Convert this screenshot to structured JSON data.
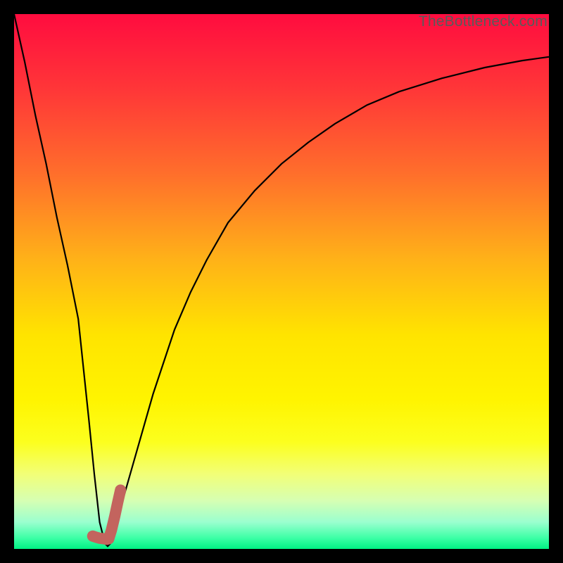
{
  "watermark": "TheBottleneck.com",
  "gradient_stops": [
    {
      "pct": 0,
      "color": "#ff0c3f"
    },
    {
      "pct": 14,
      "color": "#ff3638"
    },
    {
      "pct": 30,
      "color": "#ff6f2b"
    },
    {
      "pct": 46,
      "color": "#ffb218"
    },
    {
      "pct": 60,
      "color": "#ffe400"
    },
    {
      "pct": 72,
      "color": "#fff400"
    },
    {
      "pct": 80,
      "color": "#fcff1e"
    },
    {
      "pct": 86,
      "color": "#f2ff77"
    },
    {
      "pct": 91,
      "color": "#d6ffb3"
    },
    {
      "pct": 95,
      "color": "#9affcf"
    },
    {
      "pct": 98,
      "color": "#3bffa5"
    },
    {
      "pct": 100,
      "color": "#00f183"
    }
  ],
  "highlight_color": "#c3645e",
  "curve_color": "#000000",
  "chart_data": {
    "type": "line",
    "title": "",
    "xlabel": "",
    "ylabel": "",
    "xlim": [
      0,
      100
    ],
    "ylim": [
      0,
      100
    ],
    "series": [
      {
        "name": "bottleneck-curve",
        "x": [
          0,
          2,
          4,
          6,
          8,
          10,
          12,
          14,
          15,
          16,
          17,
          17.5,
          18,
          19,
          20,
          22,
          24,
          26,
          28,
          30,
          33,
          36,
          40,
          45,
          50,
          55,
          60,
          66,
          72,
          80,
          88,
          95,
          100
        ],
        "y": [
          100,
          91,
          81,
          72,
          62,
          53,
          43,
          24,
          14,
          5,
          1,
          0.5,
          1,
          4,
          8,
          15,
          22,
          29,
          35,
          41,
          48,
          54,
          61,
          67,
          72,
          76,
          79.5,
          83,
          85.5,
          88,
          90,
          91.3,
          92
        ]
      }
    ],
    "highlight_segment": {
      "name": "selected-range",
      "x": [
        14.7,
        15.3,
        16.0,
        16.8,
        17.3,
        17.7,
        18.2,
        18.8,
        19.4,
        19.9
      ],
      "y": [
        2.4,
        2.2,
        2.0,
        1.9,
        1.8,
        1.9,
        3.5,
        6.0,
        8.8,
        11.0
      ]
    }
  }
}
